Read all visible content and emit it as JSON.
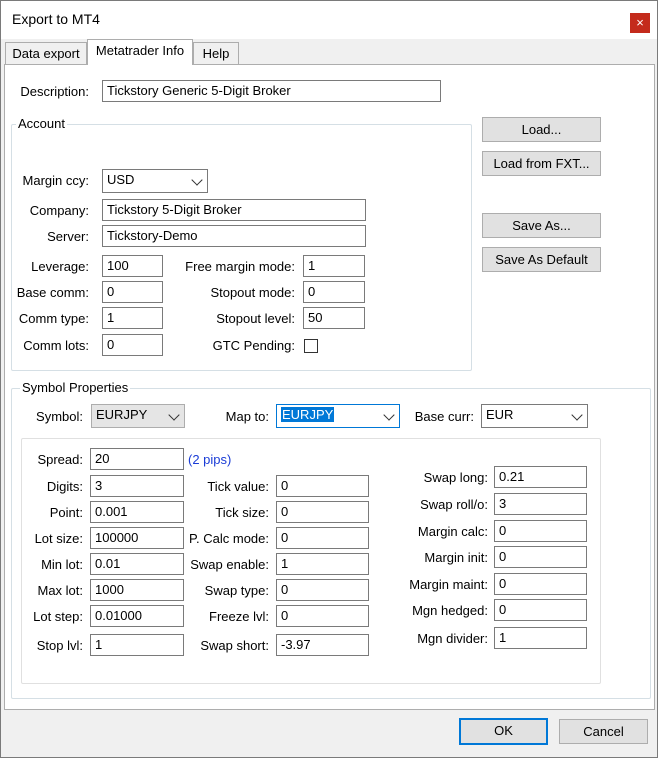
{
  "window": {
    "title": "Export to MT4",
    "close_glyph": "×"
  },
  "tabs": [
    {
      "label": "Data export"
    },
    {
      "label": "Metatrader Info"
    },
    {
      "label": "Help"
    }
  ],
  "description": {
    "label": "Description:",
    "value": "Tickstory Generic 5-Digit Broker"
  },
  "account": {
    "title": "Account",
    "margin_ccy": {
      "label": "Margin ccy:",
      "value": "USD"
    },
    "company": {
      "label": "Company:",
      "value": "Tickstory 5-Digit Broker"
    },
    "server": {
      "label": "Server:",
      "value": "Tickstory-Demo"
    },
    "leverage": {
      "label": "Leverage:",
      "value": "100"
    },
    "base_comm": {
      "label": "Base comm:",
      "value": "0"
    },
    "comm_type": {
      "label": "Comm type:",
      "value": "1"
    },
    "comm_lots": {
      "label": "Comm lots:",
      "value": "0"
    },
    "free_margin_mode": {
      "label": "Free margin mode:",
      "value": "1"
    },
    "stopout_mode": {
      "label": "Stopout mode:",
      "value": "0"
    },
    "stopout_level": {
      "label": "Stopout level:",
      "value": "50"
    },
    "gtc_pending": {
      "label": "GTC Pending:",
      "checked": false
    }
  },
  "buttons": {
    "load": "Load...",
    "load_fxt": "Load from FXT...",
    "save_as": "Save As...",
    "save_default": "Save As Default",
    "ok": "OK",
    "cancel": "Cancel"
  },
  "symbol": {
    "title": "Symbol Properties",
    "symbol": {
      "label": "Symbol:",
      "value": "EURJPY"
    },
    "map_to": {
      "label": "Map to:",
      "value": "EURJPY"
    },
    "base_curr": {
      "label": "Base curr:",
      "value": "EUR"
    },
    "spread": {
      "label": "Spread:",
      "value": "20",
      "note": "(2 pips)"
    },
    "digits": {
      "label": "Digits:",
      "value": "3"
    },
    "point": {
      "label": "Point:",
      "value": "0.001"
    },
    "lot_size": {
      "label": "Lot size:",
      "value": "100000"
    },
    "min_lot": {
      "label": "Min lot:",
      "value": "0.01"
    },
    "max_lot": {
      "label": "Max lot:",
      "value": "1000"
    },
    "lot_step": {
      "label": "Lot step:",
      "value": "0.01000"
    },
    "stop_lvl": {
      "label": "Stop lvl:",
      "value": "1"
    },
    "tick_value": {
      "label": "Tick value:",
      "value": "0"
    },
    "tick_size": {
      "label": "Tick size:",
      "value": "0"
    },
    "p_calc_mode": {
      "label": "P. Calc mode:",
      "value": "0"
    },
    "swap_enable": {
      "label": "Swap enable:",
      "value": "1"
    },
    "swap_type": {
      "label": "Swap type:",
      "value": "0"
    },
    "freeze_lvl": {
      "label": "Freeze lvl:",
      "value": "0"
    },
    "swap_short": {
      "label": "Swap short:",
      "value": "-3.97"
    },
    "swap_long": {
      "label": "Swap long:",
      "value": "0.21"
    },
    "swap_roll": {
      "label": "Swap roll/o:",
      "value": "3"
    },
    "margin_calc": {
      "label": "Margin calc:",
      "value": "0"
    },
    "margin_init": {
      "label": "Margin init:",
      "value": "0"
    },
    "margin_maint": {
      "label": "Margin maint:",
      "value": "0"
    },
    "mgn_hedged": {
      "label": "Mgn hedged:",
      "value": "0"
    },
    "mgn_divider": {
      "label": "Mgn divider:",
      "value": "1"
    }
  }
}
